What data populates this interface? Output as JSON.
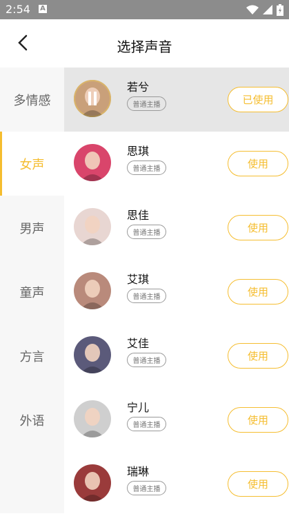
{
  "status_bar": {
    "time": "2:54",
    "notification": "A"
  },
  "header": {
    "title": "选择声音"
  },
  "sidebar": {
    "items": [
      {
        "label": "多情感",
        "active": false
      },
      {
        "label": "女声",
        "active": true
      },
      {
        "label": "男声",
        "active": false
      },
      {
        "label": "童声",
        "active": false
      },
      {
        "label": "方言",
        "active": false
      },
      {
        "label": "外语",
        "active": false
      }
    ]
  },
  "voices": [
    {
      "name": "若兮",
      "tag": "普通主播",
      "button": "已使用",
      "selected": true,
      "playing": true,
      "avatar_bg": "#c9a07a"
    },
    {
      "name": "思琪",
      "tag": "普通主播",
      "button": "使用",
      "selected": false,
      "playing": false,
      "avatar_bg": "#d9456b"
    },
    {
      "name": "思佳",
      "tag": "普通主播",
      "button": "使用",
      "selected": false,
      "playing": false,
      "avatar_bg": "#e8d6d2"
    },
    {
      "name": "艾琪",
      "tag": "普通主播",
      "button": "使用",
      "selected": false,
      "playing": false,
      "avatar_bg": "#b98a7b"
    },
    {
      "name": "艾佳",
      "tag": "普通主播",
      "button": "使用",
      "selected": false,
      "playing": false,
      "avatar_bg": "#5b5a7a"
    },
    {
      "name": "宁儿",
      "tag": "普通主播",
      "button": "使用",
      "selected": false,
      "playing": false,
      "avatar_bg": "#cfcfcf"
    },
    {
      "name": "瑞琳",
      "tag": "普通主播",
      "button": "使用",
      "selected": false,
      "playing": false,
      "avatar_bg": "#9a3b3b"
    }
  ],
  "colors": {
    "accent": "#f5bd2f",
    "status_bar": "#8c8c8c",
    "selected_row": "#e6e6e6"
  }
}
